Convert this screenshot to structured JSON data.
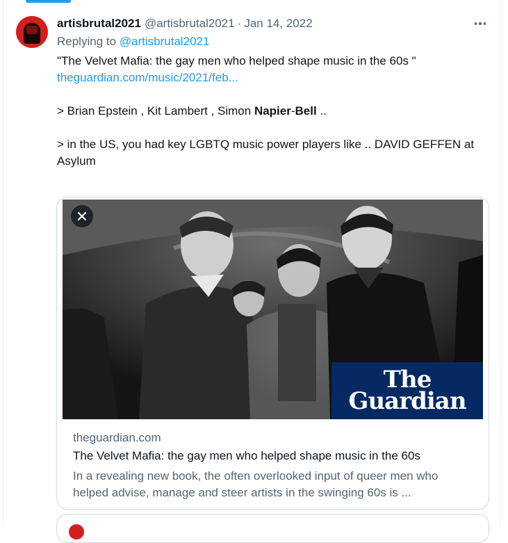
{
  "post": {
    "author_name": "artisbrutal2021",
    "author_handle": "@artisbrutal2021",
    "separator": "·",
    "date": "Jan 14, 2022",
    "replying_to_label": "Replying to",
    "replying_to_handle": "@artisbrutal2021",
    "quote_line": "\"The Velvet Mafia: the gay men who helped shape music in the 60s \"",
    "url_text": "theguardian.com/music/2021/feb...",
    "names_line_prefix": "> Brian Epstein , Kit Lambert , Simon ",
    "names_bold_1": "Napier",
    "names_hyphen": "-",
    "names_bold_2": "Bell",
    "names_line_suffix": " ..",
    "us_line": "> in the US, you had key LGBTQ music power players like .. DAVID GEFFEN at Asylum"
  },
  "card": {
    "logo_line1": "The",
    "logo_line2": "Guardian",
    "domain": "theguardian.com",
    "title": "The Velvet Mafia: the gay men who helped shape music in the 60s",
    "description": "In a revealing new book, the often overlooked input of queer men who helped advise, manage and steer artists in the swinging 60s is ..."
  },
  "icons": {
    "more": "more-horizontal-icon",
    "close": "close-icon"
  },
  "colors": {
    "link": "#1d9bf0",
    "secondary_text": "#536471",
    "guardian_blue": "#052962",
    "border": "#cfd9de"
  }
}
